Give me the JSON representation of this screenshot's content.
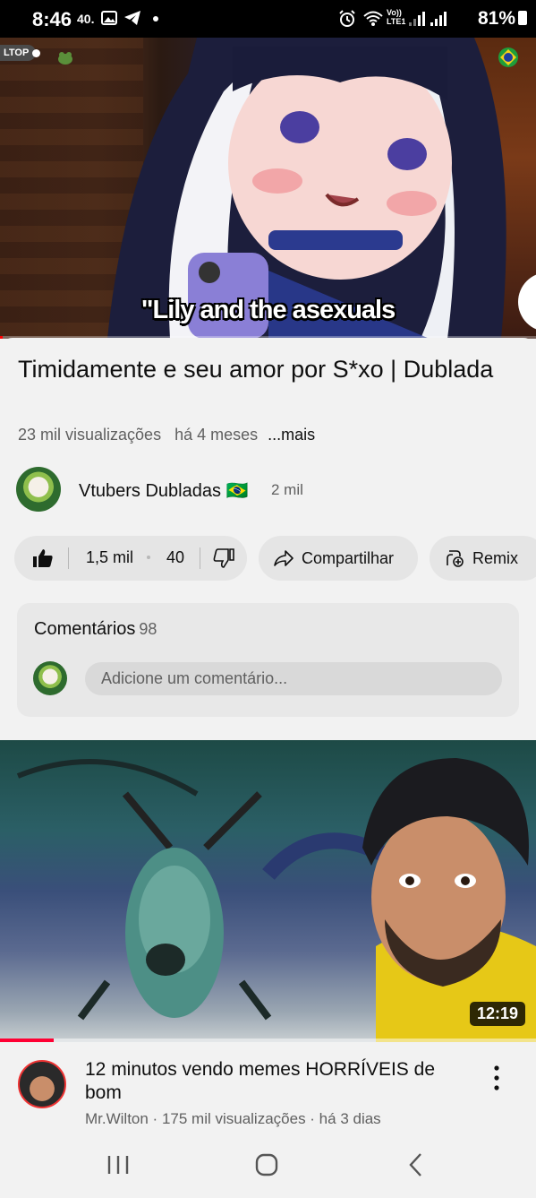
{
  "status_bar": {
    "time": "8:46",
    "notif_text": "40.",
    "network_label_top": "Vo))",
    "network_label_bottom": "LTE1",
    "battery": "81%"
  },
  "player": {
    "live_badge": "LTOP",
    "subtitle": "\"Lily and the asexuals",
    "progress_fraction": 0.005
  },
  "video": {
    "title": "Timidamente e seu amor por S*xo | Dublada",
    "views": "23 mil visualizações",
    "age": "há 4 meses",
    "more": "...mais"
  },
  "channel": {
    "name": "Vtubers Dubladas 🇧🇷",
    "subscribers": "2 mil"
  },
  "actions": {
    "likes": "1,5 mil",
    "dislike_count": "40",
    "share": "Compartilhar",
    "remix": "Remix"
  },
  "comments": {
    "title": "Comentários",
    "count": "98",
    "placeholder": "Adicione um comentário..."
  },
  "next_video": {
    "duration": "12:19",
    "progress_fraction": 0.1,
    "title": "12 minutos vendo memes HORRÍVEIS de bom",
    "meta": "Mr.Wilton · 175 mil visualizações · há 3 dias"
  },
  "nav": {
    "icons": [
      "recent-apps-icon",
      "home-icon",
      "back-icon"
    ]
  }
}
